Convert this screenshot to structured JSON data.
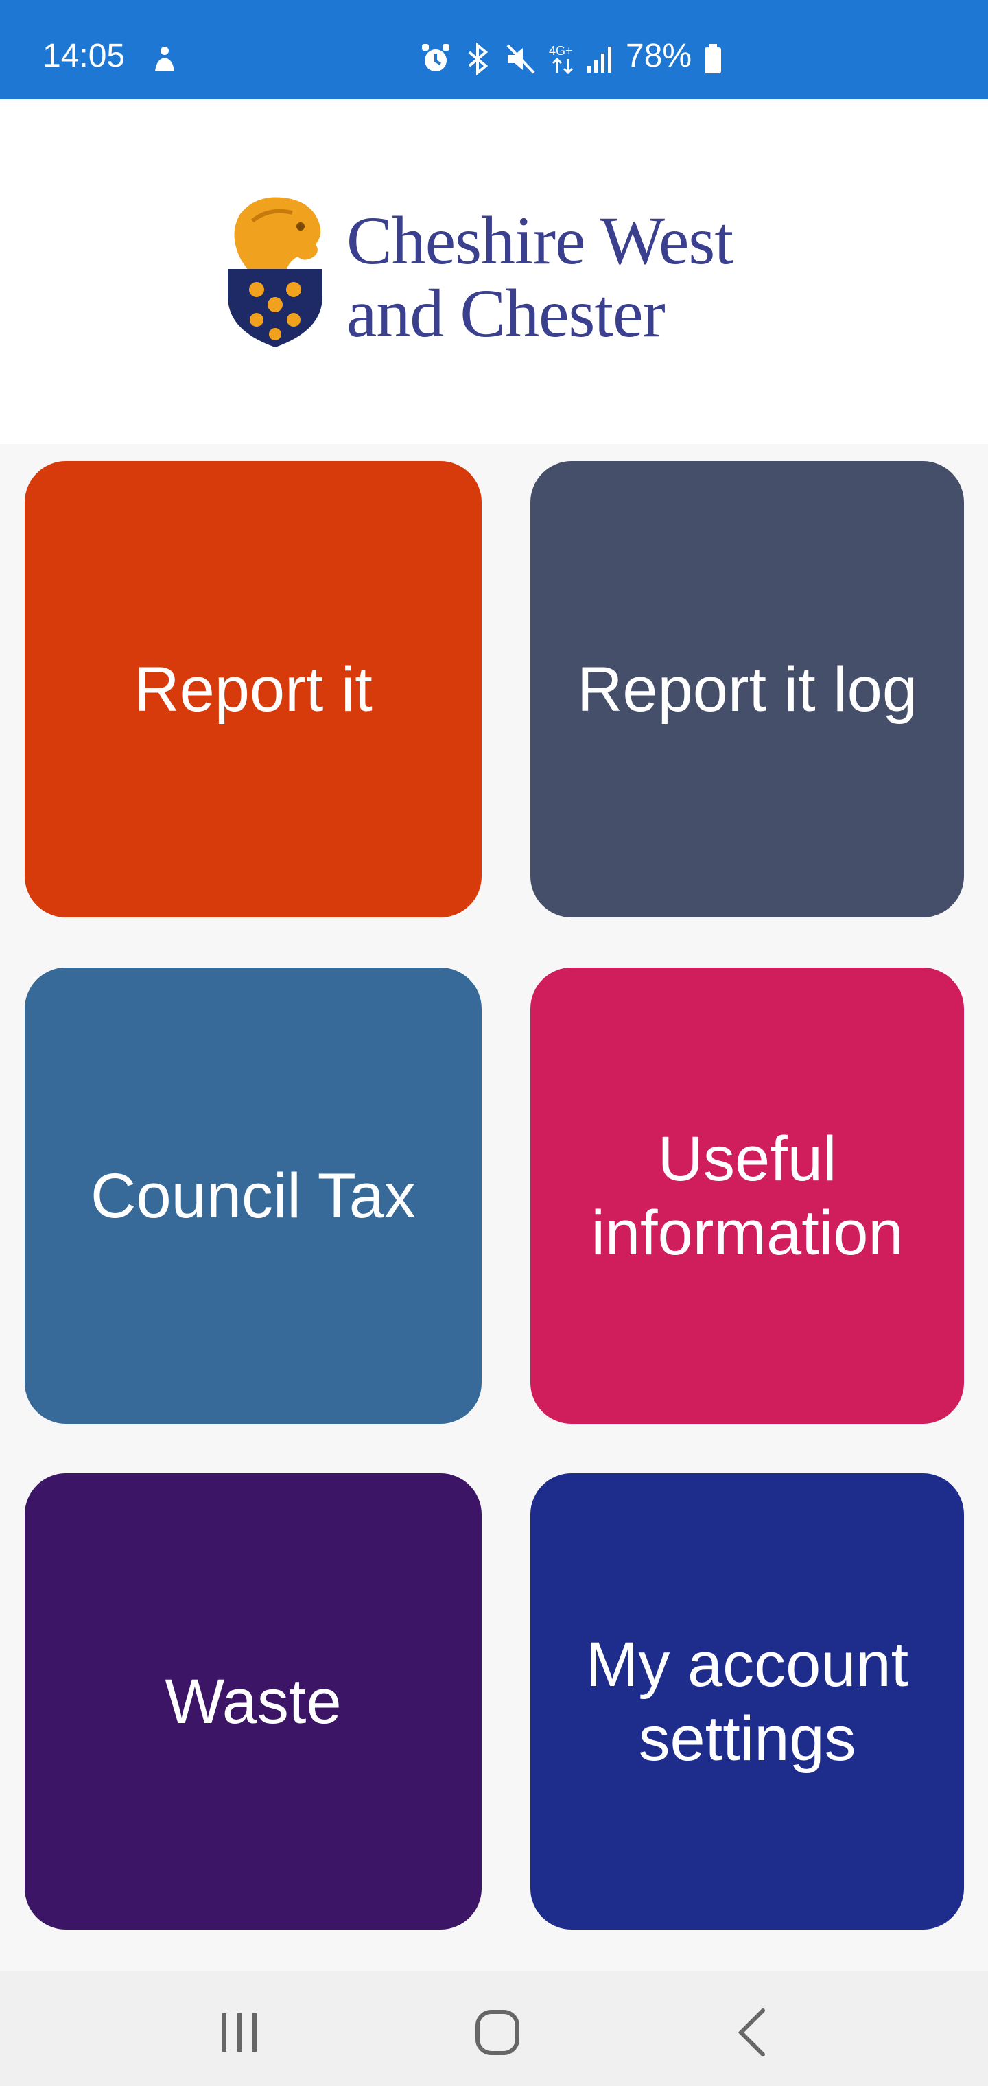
{
  "status_bar": {
    "time": "14:05",
    "battery": "78%",
    "icons": [
      "accessibility-icon",
      "alarm-icon",
      "bluetooth-icon",
      "mute-icon",
      "4g-data-icon",
      "signal-icon",
      "battery-icon"
    ],
    "background_color": "#1e77d3"
  },
  "header": {
    "logo_line1": "Cheshire West",
    "logo_line2": "and Chester",
    "logo_text_color": "#3a3f8e"
  },
  "tiles": [
    {
      "label": "Report it",
      "color": "#d83b0b"
    },
    {
      "label": "Report it log",
      "color": "#464f69"
    },
    {
      "label": "Council Tax",
      "color": "#376a98"
    },
    {
      "label": "Useful information",
      "color": "#d01d5c"
    },
    {
      "label": "Waste",
      "color": "#3d1566"
    },
    {
      "label": "My account settings",
      "color": "#1e2c8c"
    }
  ],
  "nav_bar": {
    "buttons": [
      "recent-apps-icon",
      "home-icon",
      "back-icon"
    ]
  }
}
